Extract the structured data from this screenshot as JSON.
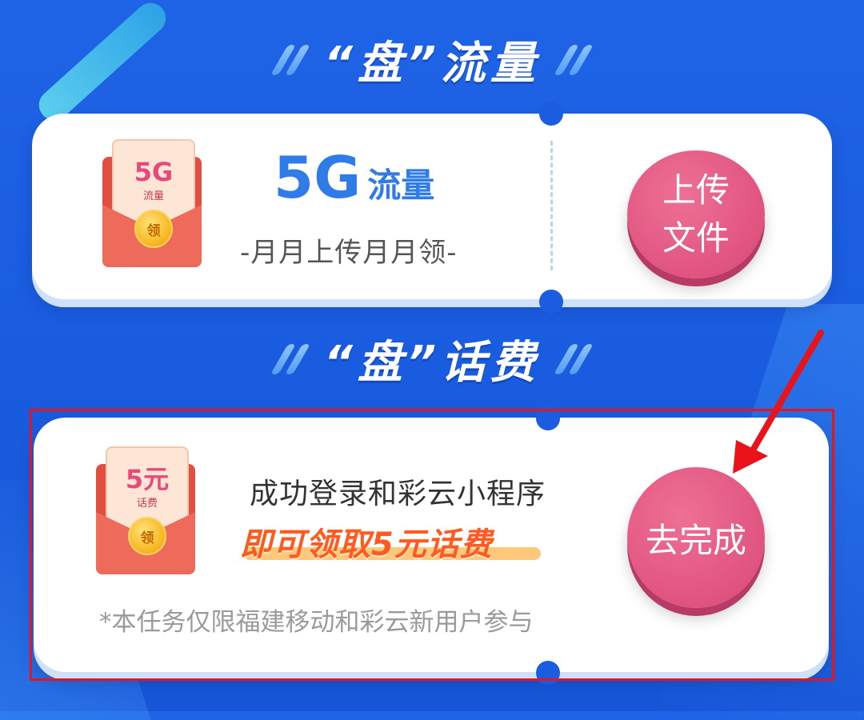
{
  "sections": {
    "data_title": "“盘”流量",
    "bill_title": "“盘”话费"
  },
  "card_data": {
    "envelope_big": "5G",
    "envelope_small": "流量",
    "coin_label": "领",
    "main_big": "5G",
    "main_word": "流量",
    "subtitle": "-月月上传月月领-",
    "button_line1": "上传",
    "button_line2": "文件"
  },
  "card_bill": {
    "envelope_big": "5元",
    "envelope_small": "话费",
    "coin_label": "领",
    "line1": "成功登录和彩云小程序",
    "highlight": "即可领取5元话费",
    "note": "*本任务仅限福建移动和彩云新用户参与",
    "button_label": "去完成"
  },
  "colors": {
    "background": "#1a5de0",
    "accent_blue": "#2f7be8",
    "button_pink": "#e05480",
    "highlight_orange": "#ff5a1f",
    "annotation_red": "#e8141a"
  }
}
